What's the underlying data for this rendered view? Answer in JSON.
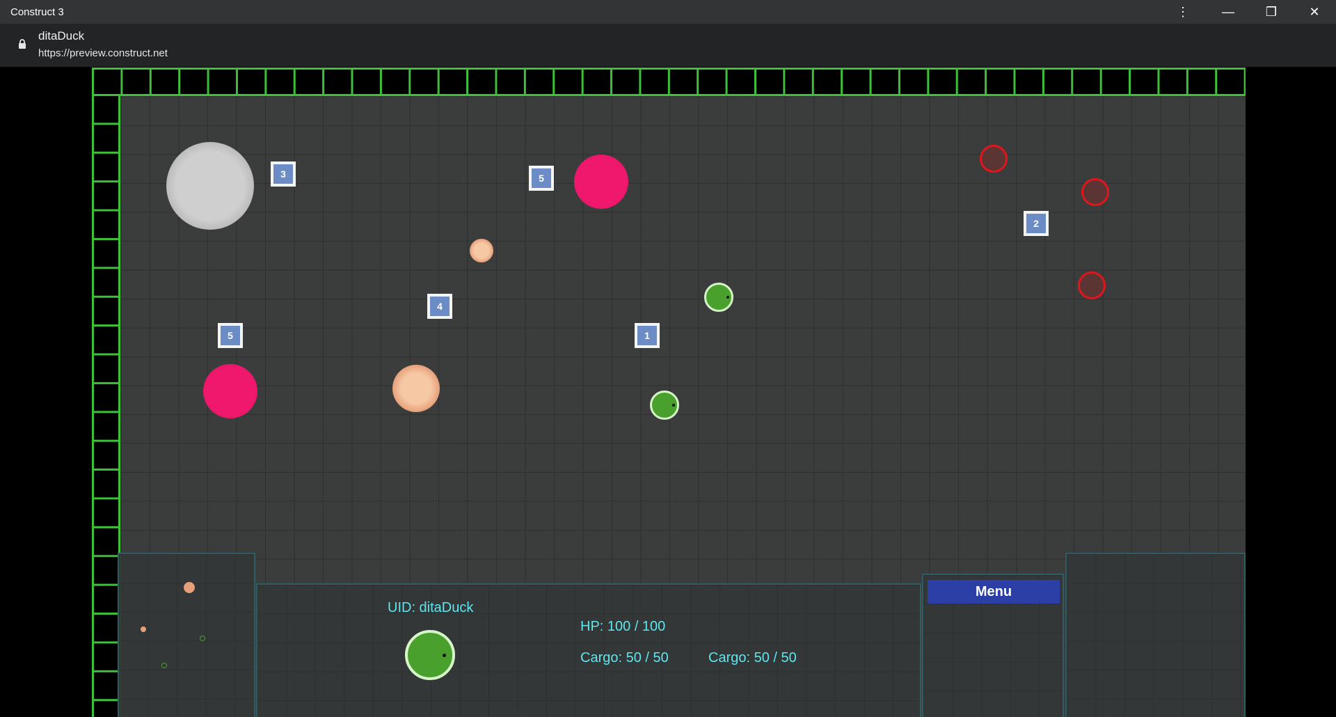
{
  "window": {
    "title": "Construct 3",
    "controls": {
      "menu_icon": "⋮",
      "minimize_icon": "—",
      "restore_icon": "❐",
      "close_icon": "✕"
    }
  },
  "address_bar": {
    "site_name": "ditaDuck",
    "url": "https://preview.construct.net"
  },
  "game": {
    "crates": [
      {
        "label": "3"
      },
      {
        "label": "5"
      },
      {
        "label": "2"
      },
      {
        "label": "4"
      },
      {
        "label": "1"
      },
      {
        "label": "5"
      }
    ],
    "hud": {
      "uid_label": "UID: ditaDuck",
      "hp_label": "HP: 100 / 100",
      "cargo_label_1": "Cargo: 50 / 50",
      "cargo_label_2": "Cargo: 50 / 50",
      "menu_label": "Menu"
    },
    "colors": {
      "wall": "#3ec03a",
      "crate": "#6b8cc4",
      "hud_text": "#5ee7ee",
      "menu_button": "#2b3fa6",
      "enemy": "#e0161c",
      "player": "#4aa02c"
    }
  }
}
